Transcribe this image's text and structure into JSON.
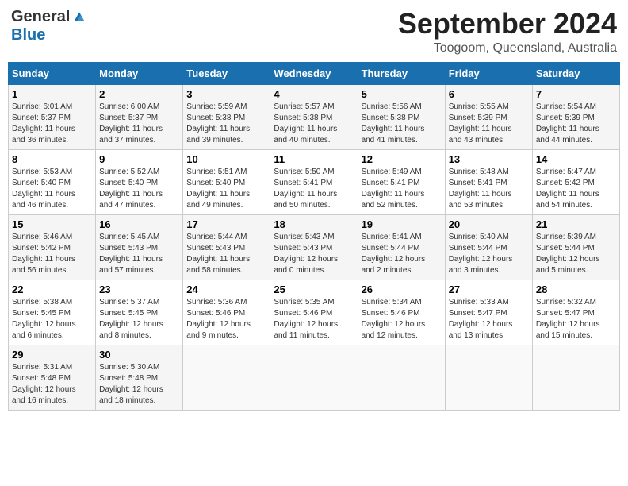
{
  "header": {
    "logo_general": "General",
    "logo_blue": "Blue",
    "month_title": "September 2024",
    "subtitle": "Toogoom, Queensland, Australia"
  },
  "weekdays": [
    "Sunday",
    "Monday",
    "Tuesday",
    "Wednesday",
    "Thursday",
    "Friday",
    "Saturday"
  ],
  "weeks": [
    [
      {
        "day": "1",
        "sunrise": "6:01 AM",
        "sunset": "5:37 PM",
        "daylight": "11 hours and 36 minutes."
      },
      {
        "day": "2",
        "sunrise": "6:00 AM",
        "sunset": "5:37 PM",
        "daylight": "11 hours and 37 minutes."
      },
      {
        "day": "3",
        "sunrise": "5:59 AM",
        "sunset": "5:38 PM",
        "daylight": "11 hours and 39 minutes."
      },
      {
        "day": "4",
        "sunrise": "5:57 AM",
        "sunset": "5:38 PM",
        "daylight": "11 hours and 40 minutes."
      },
      {
        "day": "5",
        "sunrise": "5:56 AM",
        "sunset": "5:38 PM",
        "daylight": "11 hours and 41 minutes."
      },
      {
        "day": "6",
        "sunrise": "5:55 AM",
        "sunset": "5:39 PM",
        "daylight": "11 hours and 43 minutes."
      },
      {
        "day": "7",
        "sunrise": "5:54 AM",
        "sunset": "5:39 PM",
        "daylight": "11 hours and 44 minutes."
      }
    ],
    [
      {
        "day": "8",
        "sunrise": "5:53 AM",
        "sunset": "5:40 PM",
        "daylight": "11 hours and 46 minutes."
      },
      {
        "day": "9",
        "sunrise": "5:52 AM",
        "sunset": "5:40 PM",
        "daylight": "11 hours and 47 minutes."
      },
      {
        "day": "10",
        "sunrise": "5:51 AM",
        "sunset": "5:40 PM",
        "daylight": "11 hours and 49 minutes."
      },
      {
        "day": "11",
        "sunrise": "5:50 AM",
        "sunset": "5:41 PM",
        "daylight": "11 hours and 50 minutes."
      },
      {
        "day": "12",
        "sunrise": "5:49 AM",
        "sunset": "5:41 PM",
        "daylight": "11 hours and 52 minutes."
      },
      {
        "day": "13",
        "sunrise": "5:48 AM",
        "sunset": "5:41 PM",
        "daylight": "11 hours and 53 minutes."
      },
      {
        "day": "14",
        "sunrise": "5:47 AM",
        "sunset": "5:42 PM",
        "daylight": "11 hours and 54 minutes."
      }
    ],
    [
      {
        "day": "15",
        "sunrise": "5:46 AM",
        "sunset": "5:42 PM",
        "daylight": "11 hours and 56 minutes."
      },
      {
        "day": "16",
        "sunrise": "5:45 AM",
        "sunset": "5:43 PM",
        "daylight": "11 hours and 57 minutes."
      },
      {
        "day": "17",
        "sunrise": "5:44 AM",
        "sunset": "5:43 PM",
        "daylight": "11 hours and 58 minutes."
      },
      {
        "day": "18",
        "sunrise": "5:43 AM",
        "sunset": "5:43 PM",
        "daylight": "12 hours and 0 minutes."
      },
      {
        "day": "19",
        "sunrise": "5:41 AM",
        "sunset": "5:44 PM",
        "daylight": "12 hours and 2 minutes."
      },
      {
        "day": "20",
        "sunrise": "5:40 AM",
        "sunset": "5:44 PM",
        "daylight": "12 hours and 3 minutes."
      },
      {
        "day": "21",
        "sunrise": "5:39 AM",
        "sunset": "5:44 PM",
        "daylight": "12 hours and 5 minutes."
      }
    ],
    [
      {
        "day": "22",
        "sunrise": "5:38 AM",
        "sunset": "5:45 PM",
        "daylight": "12 hours and 6 minutes."
      },
      {
        "day": "23",
        "sunrise": "5:37 AM",
        "sunset": "5:45 PM",
        "daylight": "12 hours and 8 minutes."
      },
      {
        "day": "24",
        "sunrise": "5:36 AM",
        "sunset": "5:46 PM",
        "daylight": "12 hours and 9 minutes."
      },
      {
        "day": "25",
        "sunrise": "5:35 AM",
        "sunset": "5:46 PM",
        "daylight": "12 hours and 11 minutes."
      },
      {
        "day": "26",
        "sunrise": "5:34 AM",
        "sunset": "5:46 PM",
        "daylight": "12 hours and 12 minutes."
      },
      {
        "day": "27",
        "sunrise": "5:33 AM",
        "sunset": "5:47 PM",
        "daylight": "12 hours and 13 minutes."
      },
      {
        "day": "28",
        "sunrise": "5:32 AM",
        "sunset": "5:47 PM",
        "daylight": "12 hours and 15 minutes."
      }
    ],
    [
      {
        "day": "29",
        "sunrise": "5:31 AM",
        "sunset": "5:48 PM",
        "daylight": "12 hours and 16 minutes."
      },
      {
        "day": "30",
        "sunrise": "5:30 AM",
        "sunset": "5:48 PM",
        "daylight": "12 hours and 18 minutes."
      },
      null,
      null,
      null,
      null,
      null
    ]
  ]
}
